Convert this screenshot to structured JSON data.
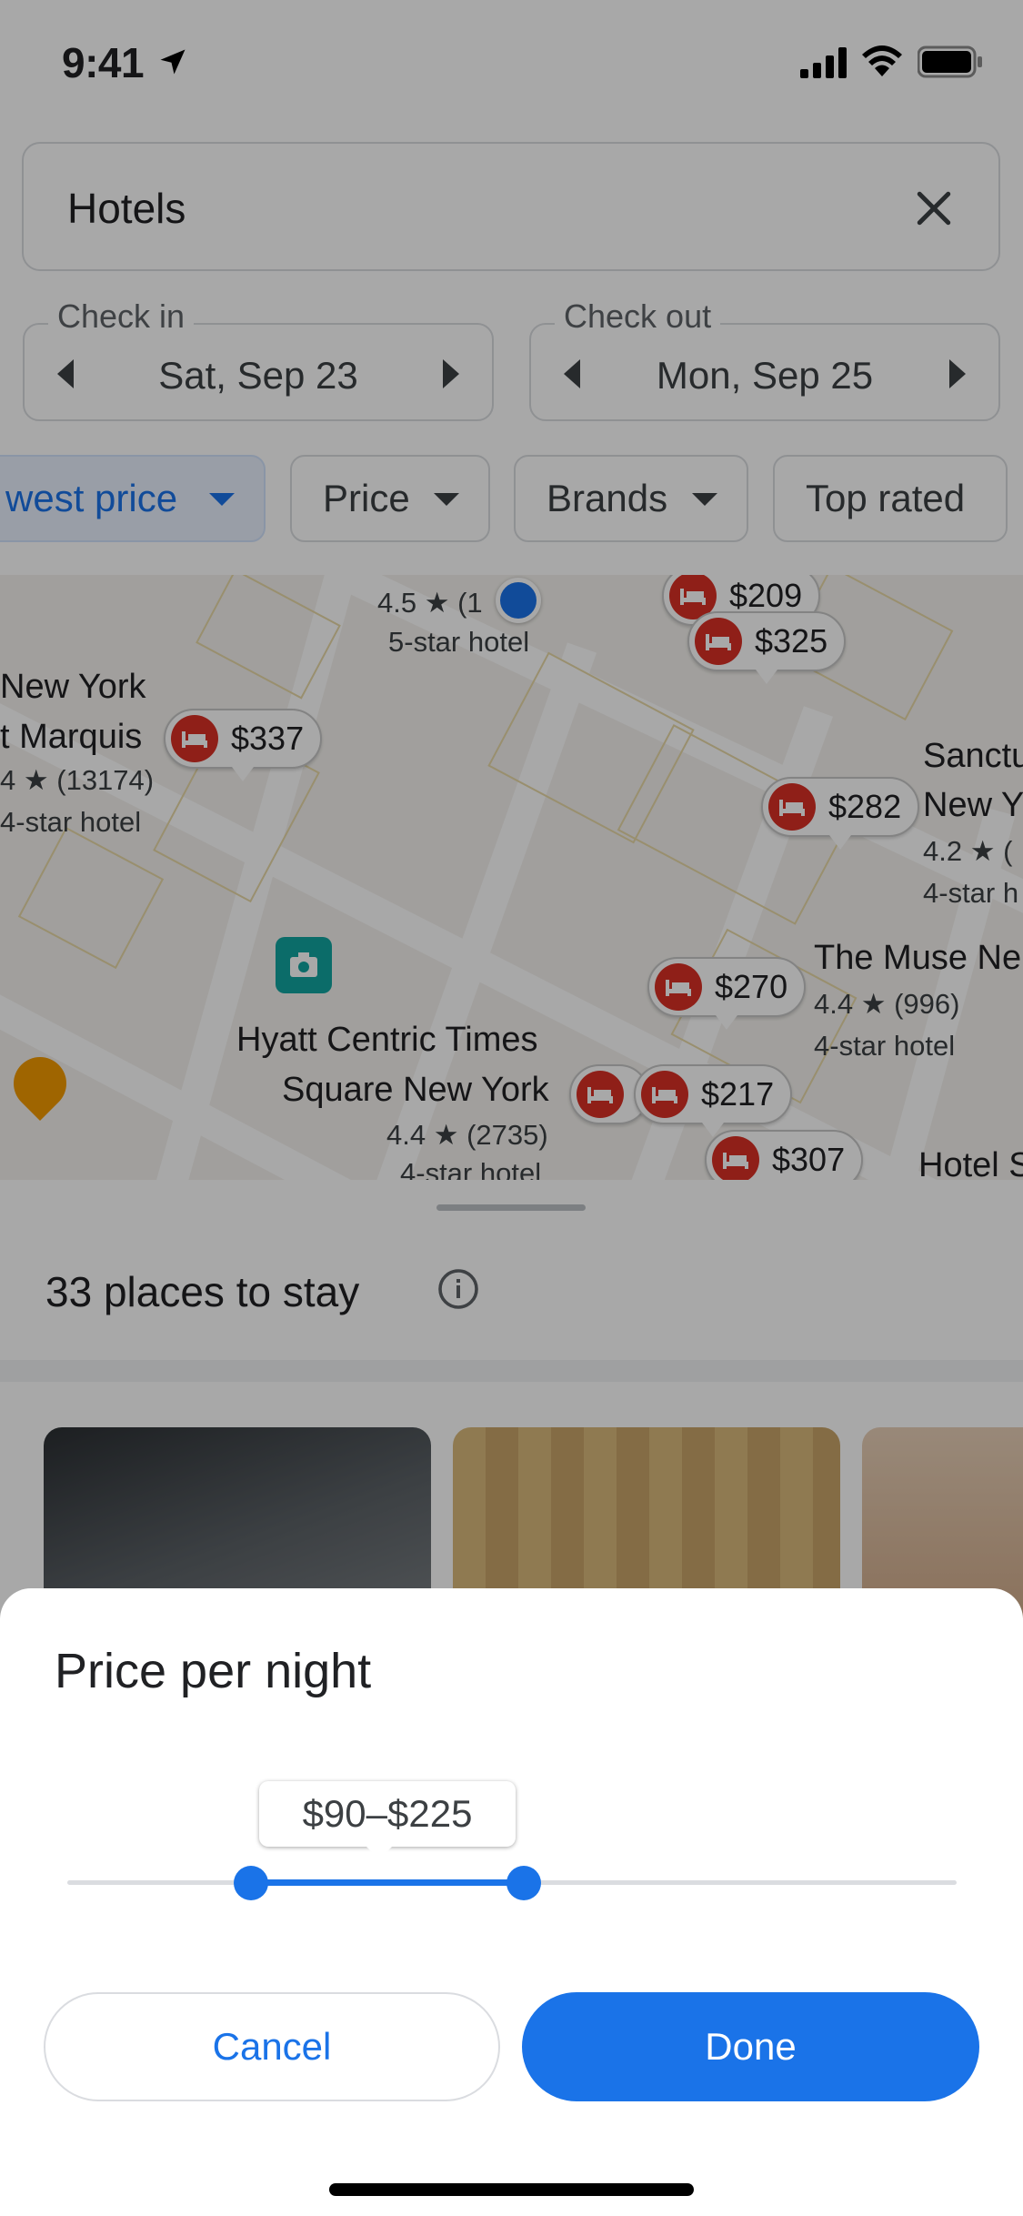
{
  "status_bar": {
    "time": "9:41"
  },
  "search": {
    "value": "Hotels"
  },
  "dates": {
    "check_in": {
      "label": "Check in",
      "value": "Sat, Sep 23"
    },
    "check_out": {
      "label": "Check out",
      "value": "Mon, Sep 25"
    }
  },
  "filters": [
    {
      "label": "west price",
      "active": true
    },
    {
      "label": "Price",
      "active": false
    },
    {
      "label": "Brands",
      "active": false
    },
    {
      "label": "Top rated",
      "active": false
    }
  ],
  "map": {
    "hotels": [
      {
        "rating_line": "4.5 ★ (1",
        "class": "5-star hotel"
      },
      {
        "name_line1": "New York",
        "name_line2": "t Marquis",
        "rating_line": "4 ★ (13174)",
        "class": "4-star hotel"
      },
      {
        "name_line1": "Sanctu",
        "name_line2": "New Y",
        "rating_line": "4.2 ★ (",
        "class": "4-star h"
      },
      {
        "name": "The Muse Ne",
        "rating_line": "4.4 ★ (996)",
        "class": "4-star hotel"
      },
      {
        "name_line1": "Hyatt Centric Times",
        "name_line2": "Square New York",
        "rating_line": "4.4 ★ (2735)",
        "class": "4-star hotel"
      },
      {
        "name": "Hotel S"
      }
    ],
    "prices": [
      "$209",
      "$325",
      "$337",
      "$282",
      "$270",
      "$217",
      "$307"
    ]
  },
  "results": {
    "title": "33 places to stay"
  },
  "price_sheet": {
    "title": "Price per night",
    "range_label": "$90–$225",
    "min_fraction": 0.206,
    "max_fraction": 0.513,
    "cancel_label": "Cancel",
    "done_label": "Done"
  },
  "colors": {
    "accent": "#1a73e8",
    "pin": "#d93025"
  }
}
